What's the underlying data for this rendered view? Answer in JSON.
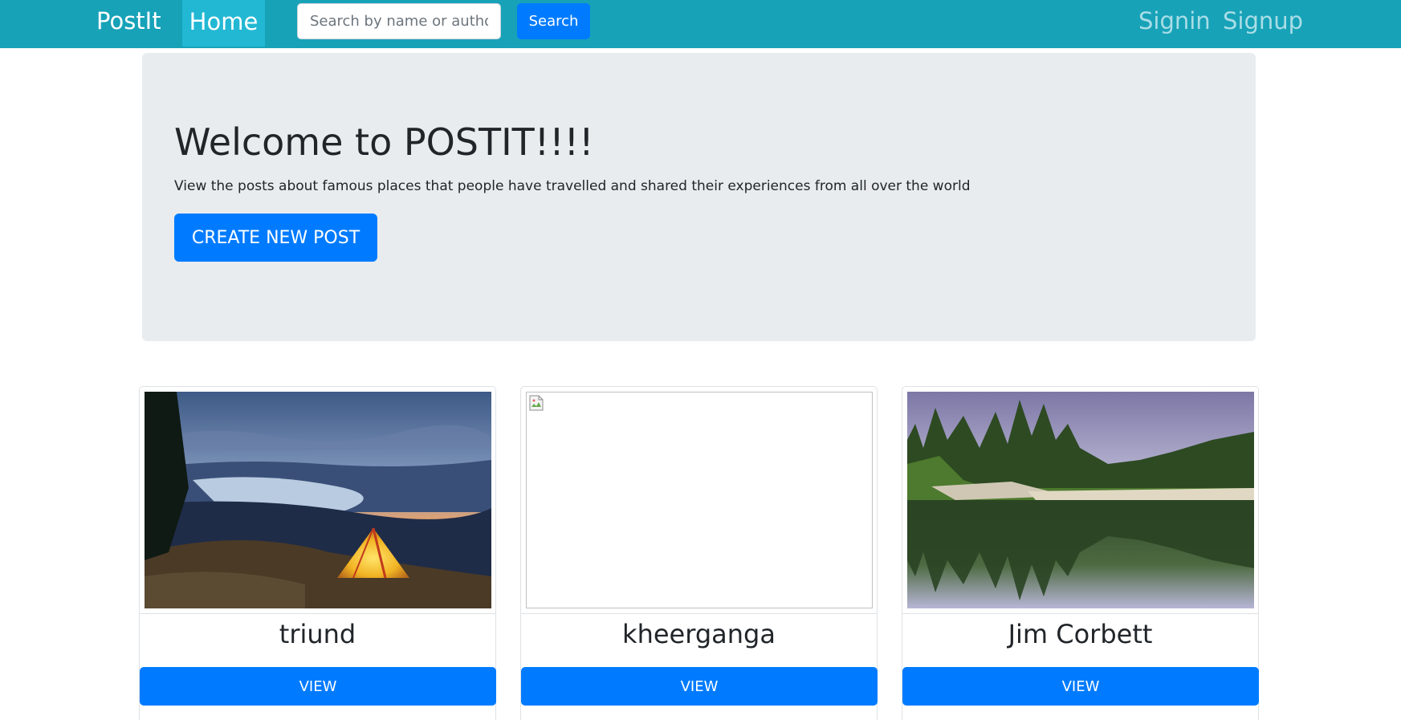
{
  "navbar": {
    "brand": "PostIt",
    "home_label": "Home",
    "search": {
      "placeholder": "Search by name or author",
      "value": ""
    },
    "search_button": "Search",
    "signin_label": "Signin",
    "signup_label": "Signup",
    "colors": {
      "background": "#17a2b8",
      "active": "#22b8d4"
    }
  },
  "jumbotron": {
    "title": "Welcome to POSTIT!!!!",
    "text": "View the posts about famous places that people have travelled and shared their experiences from all over the world",
    "button": "CREATE NEW POST"
  },
  "cards": [
    {
      "title": "triund",
      "button": "VIEW",
      "image": "camping-tent-lake-photo"
    },
    {
      "title": "kheerganga",
      "button": "VIEW",
      "image": "broken-image-icon"
    },
    {
      "title": "Jim Corbett",
      "button": "VIEW",
      "image": "forest-lake-reflection-photo"
    }
  ],
  "colors": {
    "primary": "#007bff",
    "jumbotron_bg": "#e9ecef"
  }
}
